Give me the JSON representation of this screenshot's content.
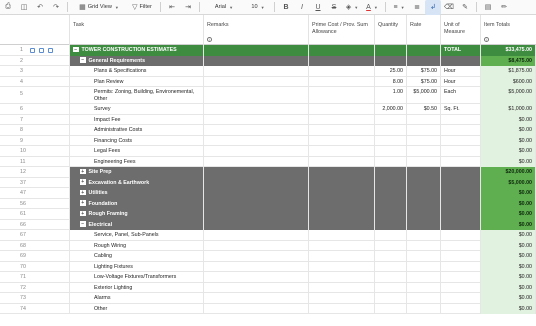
{
  "toolbar": {
    "view_label": "Grid View",
    "filter_label": "Filter",
    "font_name": "Arial",
    "font_size": "10"
  },
  "columns": {
    "task": "Task",
    "remarks": "Remarks",
    "prime": "Prime Cost / Prov. Sum Allowance",
    "quantity": "Quantity",
    "rate": "Rate",
    "unit": "Unit of Measure",
    "total": "Item Totals",
    "info_glyph": "i"
  },
  "rows": [
    {
      "num": "1",
      "type": "project",
      "task": "TOWER CONSTRUCTION ESTIMATES",
      "unit": "TOTAL",
      "total": "$33,475.00",
      "expander": "−"
    },
    {
      "num": "2",
      "type": "section",
      "task": "General Requirements",
      "total": "$8,475.00",
      "expander": "−"
    },
    {
      "num": "3",
      "type": "item",
      "task": "Plans & Specifications",
      "qty": "25.00",
      "rate": "$75.00",
      "unit": "Hour",
      "total": "$1,875.00"
    },
    {
      "num": "4",
      "type": "item",
      "task": "Plan Review",
      "qty": "8.00",
      "rate": "$75.00",
      "unit": "Hour",
      "total": "$600.00"
    },
    {
      "num": "5",
      "type": "item",
      "task": "Permits: Zoning, Building, Environemental, Other",
      "qty": "1.00",
      "rate": "$5,000.00",
      "unit": "Each",
      "total": "$5,000.00",
      "tall": true
    },
    {
      "num": "6",
      "type": "item",
      "task": "Survey",
      "qty": "2,000.00",
      "rate": "$0.50",
      "unit": "Sq. Ft.",
      "total": "$1,000.00"
    },
    {
      "num": "7",
      "type": "item",
      "task": "Impact Fee",
      "total": "$0.00"
    },
    {
      "num": "8",
      "type": "item",
      "task": "Administrative Costs",
      "total": "$0.00"
    },
    {
      "num": "9",
      "type": "item",
      "task": "Financing Costs",
      "total": "$0.00"
    },
    {
      "num": "10",
      "type": "item",
      "task": "Legal Fees",
      "total": "$0.00"
    },
    {
      "num": "11",
      "type": "item",
      "task": "Engineering Fees",
      "total": "$0.00"
    },
    {
      "num": "12",
      "type": "section",
      "task": "Site Prep",
      "total": "$20,000.00",
      "expander": "+"
    },
    {
      "num": "37",
      "type": "section",
      "task": "Excavation & Earthwork",
      "total": "$5,000.00",
      "expander": "+"
    },
    {
      "num": "47",
      "type": "section",
      "task": "Utilities",
      "total": "$0.00",
      "expander": "+"
    },
    {
      "num": "56",
      "type": "section",
      "task": "Foundation",
      "total": "$0.00",
      "expander": "+"
    },
    {
      "num": "61",
      "type": "section",
      "task": "Rough Framing",
      "total": "$0.00",
      "expander": "+"
    },
    {
      "num": "66",
      "type": "section",
      "task": "Electrical",
      "total": "$0.00",
      "expander": "−"
    },
    {
      "num": "67",
      "type": "item",
      "task": "Service, Panel, Sub-Panels",
      "total": "$0.00"
    },
    {
      "num": "68",
      "type": "item",
      "task": "Rough Wiring",
      "total": "$0.00"
    },
    {
      "num": "69",
      "type": "item",
      "task": "Cabling",
      "total": "$0.00"
    },
    {
      "num": "70",
      "type": "item",
      "task": "Lighting Fixtures",
      "total": "$0.00"
    },
    {
      "num": "71",
      "type": "item",
      "task": "Low-Voltage Fixtures/Transformers",
      "total": "$0.00"
    },
    {
      "num": "72",
      "type": "item",
      "task": "Exterior Lighting",
      "total": "$0.00"
    },
    {
      "num": "73",
      "type": "item",
      "task": "Alarms",
      "total": "$0.00"
    },
    {
      "num": "74",
      "type": "item",
      "task": "Other",
      "total": "$0.00"
    }
  ],
  "colors": {
    "project_bar": "#3d8c40",
    "section_bar": "#6d6d6d",
    "total_column": "#e2f2e0",
    "accent": "#2a5ea8"
  }
}
